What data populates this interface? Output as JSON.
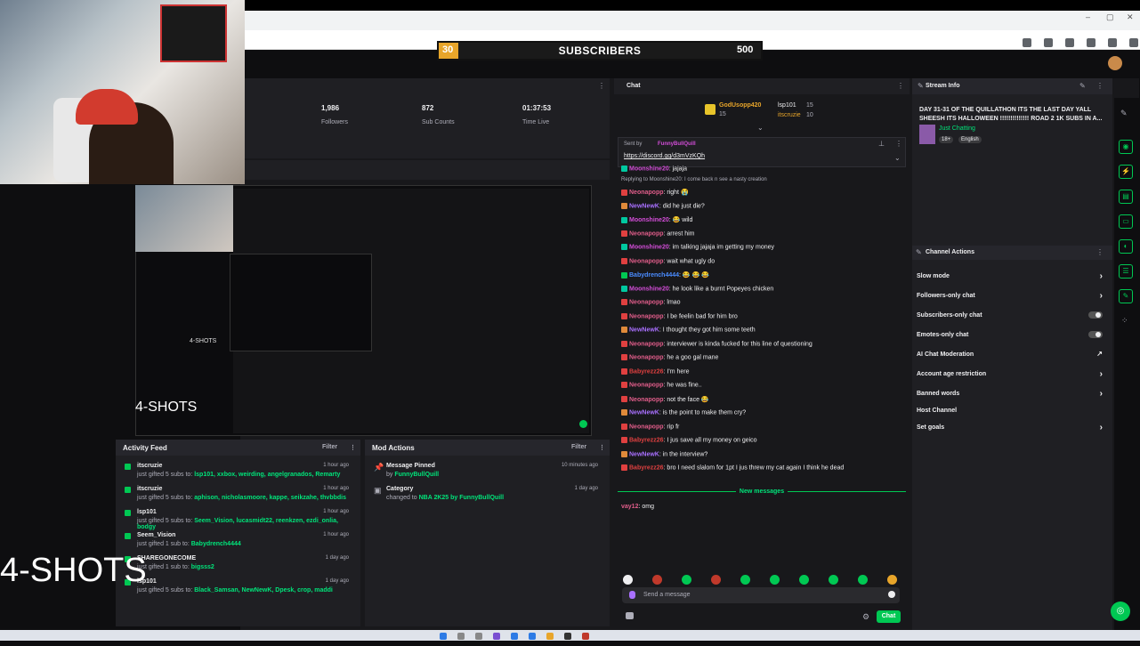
{
  "subscriber_goal": {
    "current": "30",
    "label": "SUBSCRIBERS",
    "target": "500",
    "progress": 0.06,
    "color": "#e8a52a"
  },
  "stats": {
    "followers": {
      "value": "1,986",
      "label": "Followers"
    },
    "subs": {
      "value": "872",
      "label": "Sub Counts"
    },
    "time": {
      "value": "01:37:53",
      "label": "Time Live"
    }
  },
  "overlay": {
    "shots_big": "4-SHOTS",
    "shots_small": "4-SHOTS",
    "shots_tiny": "4-SHOTS"
  },
  "activity_feed": {
    "title": "Activity Feed",
    "filter": "Filter",
    "items": [
      {
        "user": "itscruzie",
        "desc": "just gifted 5 subs to:",
        "targets": "lsp101, xxbox, weirding, angelgranados, Remarty",
        "time": "1 hour ago"
      },
      {
        "user": "itscruzie",
        "desc": "just gifted 5 subs to:",
        "targets": "aphison, nicholasmoore, kappe, seikzahe, thvbbdis",
        "time": "1 hour ago"
      },
      {
        "user": "lsp101",
        "desc": "just gifted 5 subs to:",
        "targets": "Seem_Vision, lucasmidt22, reenkzen, ezdi_onlia, bodgy",
        "time": "1 hour ago"
      },
      {
        "user": "Seem_Vision",
        "desc": "just gifted 1 sub to:",
        "targets": "Babydrench4444",
        "time": "1 hour ago"
      },
      {
        "user": "SHAREGONECOME",
        "desc": "just gifted 1 sub to:",
        "targets": "bigsss2",
        "time": "1 day ago"
      },
      {
        "user": "lsp101",
        "desc": "just gifted 5 subs to:",
        "targets": "Black_Samsan, NewNewK, Dpesk, crop, maddi",
        "time": "1 day ago"
      }
    ]
  },
  "mod_actions": {
    "title": "Mod Actions",
    "filter": "Filter",
    "items": [
      {
        "title": "Message Pinned",
        "desc": "by",
        "by": "FunnyBullQuill",
        "time": "10 minutes ago",
        "icon": "pin-icon"
      },
      {
        "title": "Category",
        "desc": "changed to",
        "by": "NBA 2K25 by FunnyBullQuill",
        "time": "1 day ago",
        "icon": "category-icon"
      }
    ]
  },
  "chat": {
    "title": "Chat",
    "leaderboard": {
      "first": "GodUsopp420",
      "first_count": "15",
      "second": "lsp101",
      "second_count": "15",
      "third": "itscruzie",
      "third_count": "10"
    },
    "pinned_by": "Sent by",
    "pinned_user": "FunnyBullQuill",
    "pinned_link": "https://discord.gg/d3mVzKQh",
    "messages": [
      {
        "user": "Moonshine20",
        "text": ": jajaja",
        "color": "#d34dd8",
        "badge": "#00c8a0"
      },
      {
        "user": "",
        "text": "Replying to Moonshine20: I come back n see a nasty creation",
        "color": "#888",
        "badge": ""
      },
      {
        "user": "Neonapopp",
        "text": ": right 😭",
        "color": "#e05d8a",
        "badge": "#e04040"
      },
      {
        "user": "NewNewK",
        "text": ": did he just die?",
        "color": "#a970ff",
        "badge": "#e08a3a"
      },
      {
        "user": "Moonshine20",
        "text": ": 😂 wild",
        "color": "#d34dd8",
        "badge": "#00c8a0"
      },
      {
        "user": "Neonapopp",
        "text": ": arrest him",
        "color": "#e05d8a",
        "badge": "#e04040"
      },
      {
        "user": "Moonshine20",
        "text": ": im talking jajaja im getting my money",
        "color": "#d34dd8",
        "badge": "#00c8a0"
      },
      {
        "user": "Neonapopp",
        "text": ": wait what ugly do",
        "color": "#e05d8a",
        "badge": "#e04040"
      },
      {
        "user": "Babydrench4444",
        "text": ": 😂 😂 😂",
        "color": "#4a8cff",
        "badge": "#00c853"
      },
      {
        "user": "Moonshine20",
        "text": ": he look like a burnt Popeyes chicken",
        "color": "#d34dd8",
        "badge": "#00c8a0"
      },
      {
        "user": "Neonapopp",
        "text": ": lmao",
        "color": "#e05d8a",
        "badge": "#e04040"
      },
      {
        "user": "Neonapopp",
        "text": ": I be feelin bad for him bro",
        "color": "#e05d8a",
        "badge": "#e04040"
      },
      {
        "user": "NewNewK",
        "text": ": I thought they got him some teeth",
        "color": "#a970ff",
        "badge": "#e08a3a"
      },
      {
        "user": "Neonapopp",
        "text": ": interviewer is kinda fucked for this line of questioning",
        "color": "#e05d8a",
        "badge": "#e04040"
      },
      {
        "user": "Neonapopp",
        "text": ": he a goo gal mane",
        "color": "#e05d8a",
        "badge": "#e04040"
      },
      {
        "user": "Babyrezz26",
        "text": ": I'm here",
        "color": "#e04040",
        "badge": "#e04040"
      },
      {
        "user": "Neonapopp",
        "text": ": he was fine..",
        "color": "#e05d8a",
        "badge": "#e04040"
      },
      {
        "user": "Neonapopp",
        "text": ": not the face 😂",
        "color": "#e05d8a",
        "badge": "#e04040"
      },
      {
        "user": "NewNewK",
        "text": ": is the point to make them cry?",
        "color": "#a970ff",
        "badge": "#e08a3a"
      },
      {
        "user": "Neonapopp",
        "text": ": rip fr",
        "color": "#e05d8a",
        "badge": "#e04040"
      },
      {
        "user": "Babyrezz26",
        "text": ": I jus save all my money on geico",
        "color": "#e04040",
        "badge": "#e04040"
      },
      {
        "user": "NewNewK",
        "text": ": in the interview?",
        "color": "#a970ff",
        "badge": "#e08a3a"
      },
      {
        "user": "Babyrezz26",
        "text": ": bro I need slalom for 1pt I jus threw my cat again I think he dead",
        "color": "#e04040",
        "badge": "#e04040"
      }
    ],
    "new_messages": "New messages",
    "last_message": {
      "user": "vay12",
      "text": ": omg",
      "color": "#e05d8a"
    },
    "placeholder": "Send a message",
    "send": "Chat"
  },
  "stream_info": {
    "title": "Stream Info",
    "stream_title": "DAY 31-31 OF THE QUILLATHON ITS THE LAST DAY YALL SHEESH ITS HALLOWEEN !!!!!!!!!!!!!! ROAD 2 1K SUBS IN A...",
    "category": "Just Chatting",
    "tags": [
      "18+",
      "English"
    ]
  },
  "channel_actions": {
    "title": "Channel Actions",
    "items": [
      {
        "label": "Slow mode",
        "type": "chevron"
      },
      {
        "label": "Followers-only chat",
        "type": "chevron"
      },
      {
        "label": "Subscribers-only chat",
        "type": "toggle"
      },
      {
        "label": "Emotes-only chat",
        "type": "toggle"
      },
      {
        "label": "AI Chat Moderation",
        "type": "icon"
      },
      {
        "label": "Account age restriction",
        "type": "chevron"
      },
      {
        "label": "Banned words",
        "type": "chevron"
      },
      {
        "label": "Host Channel",
        "type": "none"
      },
      {
        "label": "Set goals",
        "type": "chevron"
      }
    ]
  }
}
